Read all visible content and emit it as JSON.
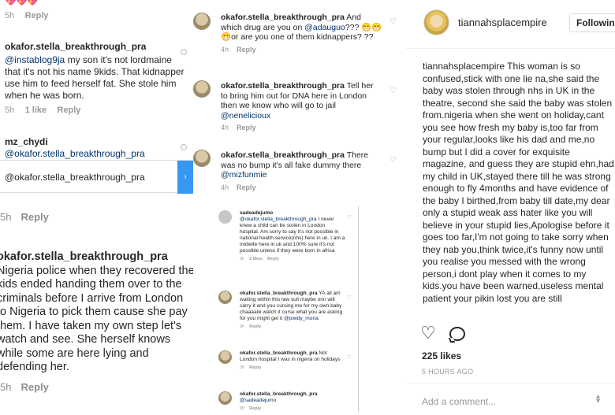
{
  "col1": {
    "hearts": "💖💖💖",
    "top_meta": {
      "time": "5h",
      "reply": "Reply"
    },
    "comment1": {
      "user": "okafor.stella_breakthrough_pra",
      "mention": "@instablog9ja",
      "text": " my son it's not lordmaine that it's not his name 9kids. That kidnapper  use him to feed herself fat. She stole him when he was born.",
      "time": "5h",
      "likes": "1 like",
      "reply": "Reply"
    },
    "comment2": {
      "user": "mz_chydi",
      "mention": "@okafor.stella_breakthrough_pra"
    },
    "input_value": "@okafor.stella_breakthrough_pra",
    "input_meta": {
      "time": "5h",
      "reply": "Reply"
    },
    "comment3": {
      "user": "okafor.stella_breakthrough_pra",
      "text": " Nigeria police when they recovered the kids ended handing them over to the criminals before I arrive from London to Nigeria to pick them cause she pay them. I have taken my own step let's watch and see. She herself knows while some are here lying and defending her.",
      "time": "5h",
      "reply": "Reply"
    }
  },
  "col2": {
    "items": [
      {
        "user": "okafor.stella_breakthrough_pra",
        "text": " And which drug are you on ",
        "mention": "@adauguo",
        "text2": "??? 😁😁😁or are you one of them kidnappers? ??",
        "time": "4h",
        "reply": "Reply"
      },
      {
        "user": "okafor.stella_breakthrough_pra",
        "text": " Tell her to bring him out for DNA here in London then we know who will go to jail ",
        "mention": "@nenelicioux",
        "time": "4h",
        "reply": "Reply"
      },
      {
        "user": "okafor.stella_breakthrough_pra",
        "text": " There was no bump it's all fake dummy there ",
        "mention": "@mizfunmie",
        "time": "4h",
        "reply": "Reply"
      }
    ],
    "small": [
      {
        "user": "sadeadejumo",
        "mention": "@okafor.stella_breakthrough_pra",
        "text": " I never knew a child can be stolen in London hospital. Am sorry to say it's not possible in national health service(nhs) here in uk. I am a midwife here in uk and 100% sure it's not possible unless if they were born in africa",
        "time": "3h",
        "likes": "2 likes",
        "reply": "Reply"
      },
      {
        "user": "okafor.stella_breakthrough_pra",
        "mention": "",
        "text": " YA all am waiting within this law suit maybe onn will carry it and you cursing me for my own baby chaaaaiiii watch it curse what you are asking for you might get it ",
        "mention2": "@pwidy_mona",
        "time": "3h",
        "reply": "Reply"
      },
      {
        "user": "okafor.stella_breakthrough_pra",
        "mention": "",
        "text": " Not London hospital I was in nigeria on holidays",
        "time": "3h",
        "reply": "Reply"
      },
      {
        "user": "okafor.stella_breakthrough_pra",
        "mention": "@sadeadejumo",
        "text": "",
        "time": "3h",
        "reply": "Reply"
      }
    ]
  },
  "col3": {
    "username": "tiannahsplacempire",
    "follow_label": "Following",
    "caption_user": "tiannahsplacempire",
    "caption_text": " This woman is so confused,stick with one lie na,she said the baby was stolen through nhs in UK in the theatre, second she said the baby was stolen from.nigeria when she went on holiday,cant you see how fresh my baby is,too far from your regular,looks like his dad and me,no bump but I did a cover for exquisite magazine, and guess they are stupid ehn,had my child in UK,stayed there till he was strong enough to fly 4months and have evidence of the baby I birthed,from baby till date,my dear only a stupid weak ass hater like you will believe in your stupid lies,Apologise before it goes too far,I'm not going to take sorry when they nab you,think twice,it's funny now until you realise you messed with the wrong person,i dont play when it comes to my kids.you have been warned,useless mental patient your pikin lost you are still",
    "likes": "225 likes",
    "time": "5 HOURS AGO",
    "comment_placeholder": "Add a comment..."
  }
}
